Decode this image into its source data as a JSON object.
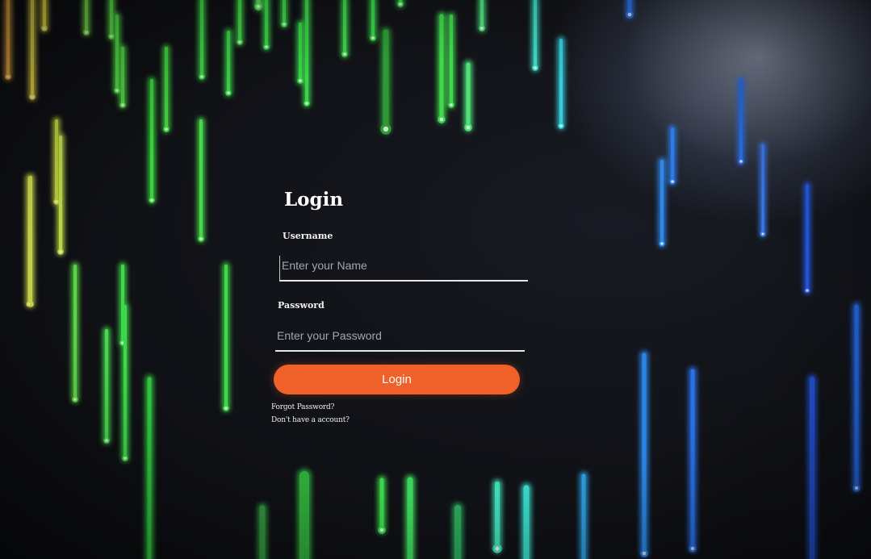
{
  "login": {
    "title": "Login",
    "username_label": "Username",
    "username_placeholder": "Enter your Name",
    "password_label": "Password",
    "password_placeholder": "Enter your Password",
    "button_label": "Login",
    "forgot_link": "Forgot Password?",
    "signup_link": "Don't have a account?"
  },
  "theme": {
    "background": "#111214",
    "button_color": "#f0612a",
    "text_color": "#ffffff"
  }
}
